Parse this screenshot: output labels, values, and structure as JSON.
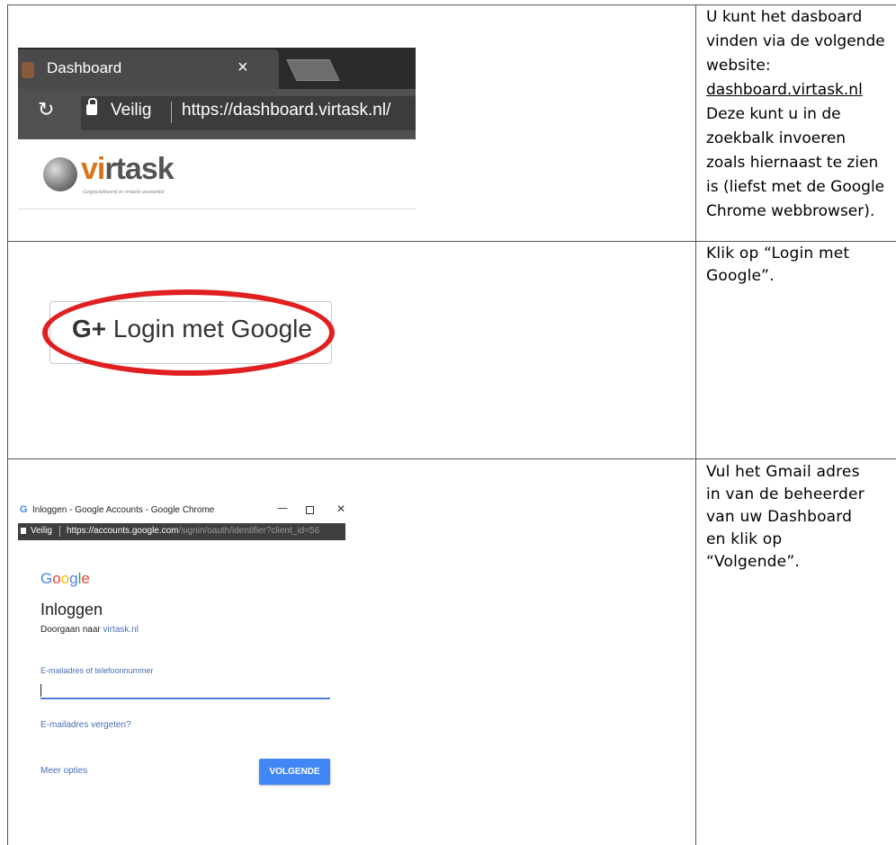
{
  "row1": {
    "description": [
      "U kunt het dasboard",
      "vinden via de volgende",
      "website:"
    ],
    "link": "dashboard.virtask.nl",
    "description_after": [
      "Deze kunt u in de",
      "zoekbalk invoeren",
      "zoals hiernaast te zien",
      "is (liefst met de Google",
      "Chrome webbrowser)."
    ],
    "browser": {
      "tab_title": "Dashboard",
      "tab_close": "×",
      "secure_label": "Veilig",
      "url": "https://dashboard.virtask.nl/"
    },
    "logo": {
      "part1": "vi",
      "part2": "rtask",
      "tagline": "Gespecialiseerd in virtuele assistentie"
    }
  },
  "row2": {
    "description": [
      "Klik op “Login met",
      "Google”."
    ],
    "button_icon": "G+",
    "button_label": "Login met Google",
    "highlight_color": "#e02020"
  },
  "row3": {
    "description": [
      "Vul het Gmail adres",
      "in van de beheerder",
      "van uw Dashboard",
      "en klik op",
      "“Volgende”."
    ],
    "window_title": "Inloggen - Google Accounts - Google Chrome",
    "window_icon": "G",
    "secure_label": "Veilig",
    "url_main": "https://accounts.google.com",
    "url_rest": "/signin/oauth/identifier?client_id=56",
    "google_logo": [
      "G",
      "o",
      "o",
      "g",
      "l",
      "e"
    ],
    "heading": "Inloggen",
    "continue_text": "Doorgaan naar",
    "continue_link": "virtask.nl",
    "field_label": "E-mailadres of telefoonnummer",
    "field_value": "",
    "forgot_link": "E-mailadres vergeten?",
    "more_options": "Meer opties",
    "next_button": "VOLGENDE",
    "accent_color": "#4285f4"
  }
}
